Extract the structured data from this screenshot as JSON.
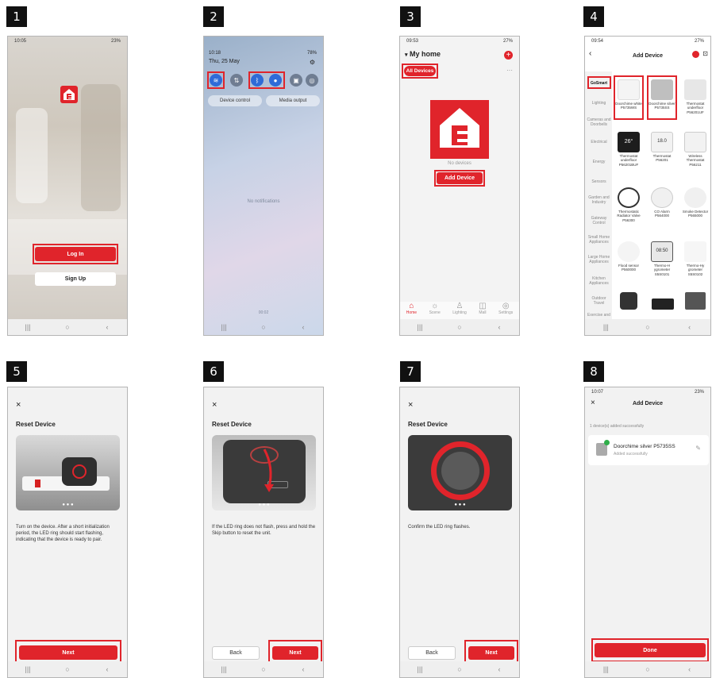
{
  "steps": [
    "1",
    "2",
    "3",
    "4",
    "5",
    "6",
    "7",
    "8"
  ],
  "screen1": {
    "status_time": "10:05",
    "status_right": "23%",
    "login": "Log In",
    "signup": "Sign Up"
  },
  "screen2": {
    "time": "10:18",
    "date": "Thu, 25 May",
    "status_right": "78%",
    "device_control": "Device control",
    "media_output": "Media output",
    "no_notifications": "No notifications",
    "bottom_time": "00:02"
  },
  "screen3": {
    "time": "09:53",
    "status_right": "27%",
    "home_title": "My home",
    "all_devices": "All Devices",
    "no_devices": "No devices",
    "add_device": "Add Device",
    "nav": [
      "Home",
      "Scene",
      "Lighting",
      "Mall",
      "Settings"
    ]
  },
  "screen4": {
    "time": "09:54",
    "status_right": "27%",
    "title": "Add Device",
    "categories": [
      "GoSmart",
      "Lighting",
      "Cameras and Doorbells",
      "Electrical",
      "Energy",
      "Sensors",
      "Garden and Industry",
      "Gateway Control",
      "Small Home Appliances",
      "Large Home Appliances",
      "Kitchen Appliances",
      "Outdoor Travel",
      "Exercise and"
    ],
    "devices": [
      "Doorchime white P5735WS",
      "Doorchime silver P5735SS",
      "Thermostat underfloor P56201UF",
      "Thermostat underfloor P56201BUF",
      "Thermostat P56201",
      "Wireless Thermostat P56211",
      "Thermostatic Radiator Valve P56300",
      "CO Alarm P564000",
      "Smoke Detector P565000",
      "Flood sensor P560000",
      "Thermo-H ygrometer S5S0101",
      "Thermo-Hy grometer S5S0102"
    ],
    "lcd1": "26°",
    "lcd2": "18.0",
    "lcd3": "08:50"
  },
  "screen5": {
    "title": "Reset Device",
    "desc": "Turn on the device. After a short initialization period, the LED ring should start flashing, indicating that the device is ready to pair.",
    "next": "Next"
  },
  "screen6": {
    "title": "Reset Device",
    "desc": "If the LED ring does not flash, press and hold the Skip button to reset the unit.",
    "back": "Back",
    "next": "Next"
  },
  "screen7": {
    "title": "Reset Device",
    "desc": "Confirm the LED ring flashes.",
    "back": "Back",
    "next": "Next"
  },
  "screen8": {
    "time": "10:07",
    "status_right": "23%",
    "title": "Add Device",
    "added_msg": "1 device(s) added successfully",
    "device_name": "Doorchime silver P5735SS",
    "device_status": "Added successfully",
    "done": "Done"
  },
  "colors": {
    "accent": "#e0242b"
  }
}
